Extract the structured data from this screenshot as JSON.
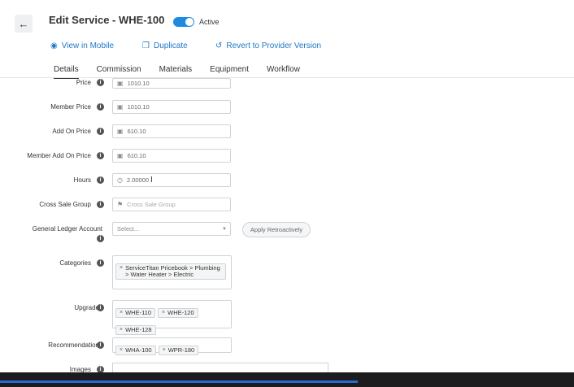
{
  "header": {
    "title": "Edit Service - WHE-100",
    "active_label": "Active",
    "back_icon": "arrow-left-icon"
  },
  "actions": [
    {
      "label": "View in Mobile",
      "icon": "eye-icon"
    },
    {
      "label": "Duplicate",
      "icon": "copy-icon"
    },
    {
      "label": "Revert to Provider Version",
      "icon": "revert-icon"
    }
  ],
  "tabs": [
    "Details",
    "Commission",
    "Materials",
    "Equipment",
    "Workflow"
  ],
  "active_tab": "Details",
  "fields": {
    "price": {
      "label": "Price",
      "value": "1010.10"
    },
    "member_price": {
      "label": "Member Price",
      "value": "1010.10"
    },
    "add_on_price": {
      "label": "Add On Price",
      "value": "610.10"
    },
    "member_add_on_price": {
      "label": "Member Add On Price",
      "value": "610.10"
    },
    "hours": {
      "label": "Hours",
      "value": "2.00000"
    },
    "cross_sale_group": {
      "label": "Cross Sale Group",
      "placeholder": "Cross Sale Group"
    },
    "gl_account": {
      "label": "General Ledger Account",
      "placeholder": "Select...",
      "button": "Apply Retroactively"
    },
    "categories": {
      "label": "Categories",
      "chips": [
        "ServiceTitan Pricebook > Plumbing > Water Heater > Electric"
      ]
    },
    "upgrades": {
      "label": "Upgrades",
      "chips": [
        "WHE-110",
        "WHE-120",
        "WHE-128"
      ]
    },
    "recommendations": {
      "label": "Recommendations",
      "chips": [
        "WHA-100",
        "WPR-180"
      ]
    },
    "images": {
      "label": "Images"
    }
  },
  "colors": {
    "accent": "#1f78c8",
    "toggle": "#1f8be0"
  }
}
